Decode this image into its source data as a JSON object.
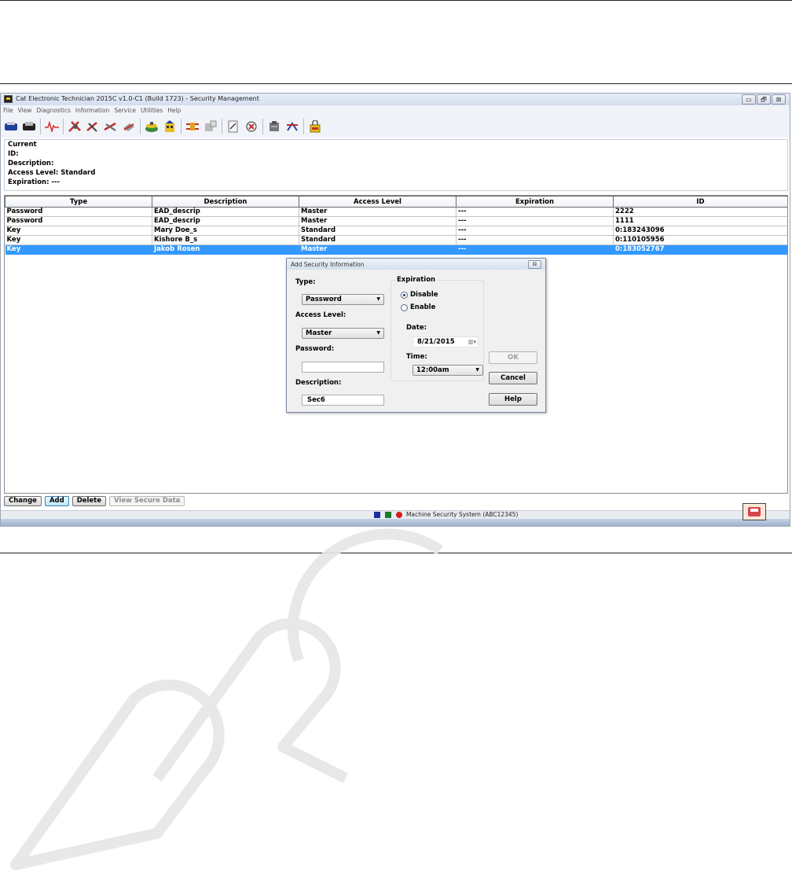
{
  "window": {
    "title": "Cat Electronic Technician 2015C v1.0-C1 (Build 1723) - Security Management",
    "buttons": [
      "▭",
      "🗗",
      "⊠"
    ]
  },
  "menu": [
    "File",
    "View",
    "Diagnostics",
    "Information",
    "Service",
    "Utilities",
    "Help"
  ],
  "current": {
    "heading": "Current",
    "id": "ID:",
    "description": "Description:",
    "access_level": "Access Level:  Standard",
    "expiration": "Expiration:  ---"
  },
  "table": {
    "columns": [
      "Type",
      "Description",
      "Access Level",
      "Expiration",
      "ID"
    ],
    "rows": [
      [
        "Password",
        "EAD_descrip",
        "Master",
        "---",
        "2222"
      ],
      [
        "Password",
        "EAD_descrip",
        "Master",
        "---",
        "1111"
      ],
      [
        "Key",
        "Mary Doe_s",
        "Standard",
        "---",
        "0:183243096"
      ],
      [
        "Key",
        "Kishore B_s",
        "Standard",
        "---",
        "0:110105956"
      ],
      [
        "Key",
        "Jakob Rosen",
        "Master",
        "---",
        "0:183052767"
      ]
    ]
  },
  "dialog": {
    "title": "Add Security Information",
    "close": "⊠",
    "type_label": "Type:",
    "type_value": "Password",
    "access_label": "Access Level:",
    "access_value": "Master",
    "password_label": "Password:",
    "password_value": "",
    "description_label": "Description:",
    "description_value": "Sec6",
    "expiration_label": "Expiration",
    "disable_label": "Disable",
    "enable_label": "Enable",
    "date_label": "Date:",
    "date_value": "8/21/2015",
    "time_label": "Time:",
    "time_value": "12:00am",
    "ok": "OK",
    "cancel": "Cancel",
    "help": "Help"
  },
  "bottom_buttons": {
    "change": "Change",
    "add": "Add",
    "delete": "Delete",
    "view": "View Secure Data"
  },
  "status": {
    "text": "Machine Security System (ABC12345)",
    "colors": [
      "#1a2fa0",
      "#1a7a2a",
      "#d41c1c"
    ]
  }
}
